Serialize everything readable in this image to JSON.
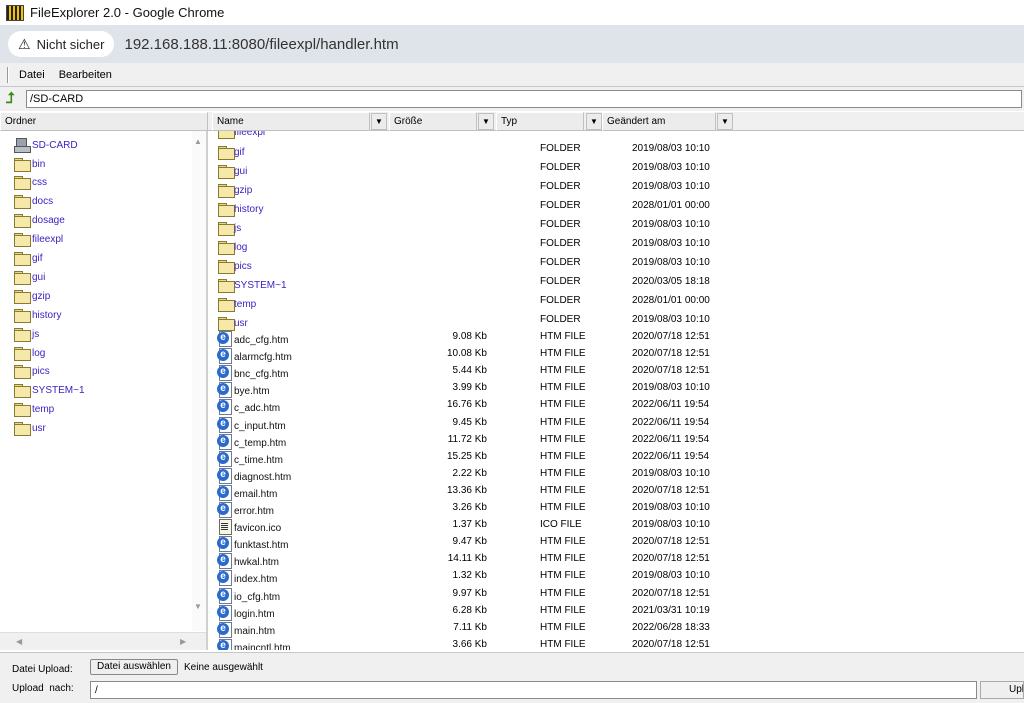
{
  "window": {
    "title": "FileExplorer 2.0 - Google Chrome"
  },
  "address": {
    "security_label": "Nicht sicher",
    "url": "192.168.188.11:8080/fileexpl/handler.htm"
  },
  "menu": {
    "items": [
      "Datei",
      "Bearbeiten"
    ]
  },
  "path": {
    "value": "/SD-CARD"
  },
  "columns": {
    "folder": "Ordner",
    "name": "Name",
    "size": "Größe",
    "type": "Typ",
    "changed": "Geändert am"
  },
  "tree": {
    "root": "SD-CARD",
    "items": [
      "bin",
      "css",
      "docs",
      "dosage",
      "fileexpl",
      "gif",
      "gui",
      "gzip",
      "history",
      "js",
      "log",
      "pics",
      "SYSTEM~1",
      "temp",
      "usr"
    ]
  },
  "files": {
    "partial_top": "fileexpl",
    "rows": [
      {
        "name": "gif",
        "size": "",
        "type": "FOLDER",
        "date": "2019/08/03 10:10",
        "icon": "folder-icon"
      },
      {
        "name": "gui",
        "size": "",
        "type": "FOLDER",
        "date": "2019/08/03 10:10",
        "icon": "folder-icon"
      },
      {
        "name": "gzip",
        "size": "",
        "type": "FOLDER",
        "date": "2019/08/03 10:10",
        "icon": "folder-icon"
      },
      {
        "name": "history",
        "size": "",
        "type": "FOLDER",
        "date": "2028/01/01 00:00",
        "icon": "folder-icon"
      },
      {
        "name": "js",
        "size": "",
        "type": "FOLDER",
        "date": "2019/08/03 10:10",
        "icon": "folder-icon"
      },
      {
        "name": "log",
        "size": "",
        "type": "FOLDER",
        "date": "2019/08/03 10:10",
        "icon": "folder-icon"
      },
      {
        "name": "pics",
        "size": "",
        "type": "FOLDER",
        "date": "2019/08/03 10:10",
        "icon": "folder-icon"
      },
      {
        "name": "SYSTEM~1",
        "size": "",
        "type": "FOLDER",
        "date": "2020/03/05 18:18",
        "icon": "folder-icon"
      },
      {
        "name": "temp",
        "size": "",
        "type": "FOLDER",
        "date": "2028/01/01 00:00",
        "icon": "folder-icon"
      },
      {
        "name": "usr",
        "size": "",
        "type": "FOLDER",
        "date": "2019/08/03 10:10",
        "icon": "folder-icon"
      },
      {
        "name": "adc_cfg.htm",
        "size": "9.08 Kb",
        "type": "HTM FILE",
        "date": "2020/07/18 12:51",
        "icon": "htm-file-icon"
      },
      {
        "name": "alarmcfg.htm",
        "size": "10.08 Kb",
        "type": "HTM FILE",
        "date": "2020/07/18 12:51",
        "icon": "htm-file-icon"
      },
      {
        "name": "bnc_cfg.htm",
        "size": "5.44 Kb",
        "type": "HTM FILE",
        "date": "2020/07/18 12:51",
        "icon": "htm-file-icon"
      },
      {
        "name": "bye.htm",
        "size": "3.99 Kb",
        "type": "HTM FILE",
        "date": "2019/08/03 10:10",
        "icon": "htm-file-icon"
      },
      {
        "name": "c_adc.htm",
        "size": "16.76 Kb",
        "type": "HTM FILE",
        "date": "2022/06/11 19:54",
        "icon": "htm-file-icon"
      },
      {
        "name": "c_input.htm",
        "size": "9.45 Kb",
        "type": "HTM FILE",
        "date": "2022/06/11 19:54",
        "icon": "htm-file-icon"
      },
      {
        "name": "c_temp.htm",
        "size": "11.72 Kb",
        "type": "HTM FILE",
        "date": "2022/06/11 19:54",
        "icon": "htm-file-icon"
      },
      {
        "name": "c_time.htm",
        "size": "15.25 Kb",
        "type": "HTM FILE",
        "date": "2022/06/11 19:54",
        "icon": "htm-file-icon"
      },
      {
        "name": "diagnost.htm",
        "size": "2.22 Kb",
        "type": "HTM FILE",
        "date": "2019/08/03 10:10",
        "icon": "htm-file-icon"
      },
      {
        "name": "email.htm",
        "size": "13.36 Kb",
        "type": "HTM FILE",
        "date": "2020/07/18 12:51",
        "icon": "htm-file-icon"
      },
      {
        "name": "error.htm",
        "size": "3.26 Kb",
        "type": "HTM FILE",
        "date": "2019/08/03 10:10",
        "icon": "htm-file-icon"
      },
      {
        "name": "favicon.ico",
        "size": "1.37 Kb",
        "type": "ICO FILE",
        "date": "2019/08/03 10:10",
        "icon": "ico-file-icon"
      },
      {
        "name": "funktast.htm",
        "size": "9.47 Kb",
        "type": "HTM FILE",
        "date": "2020/07/18 12:51",
        "icon": "htm-file-icon"
      },
      {
        "name": "hwkal.htm",
        "size": "14.11 Kb",
        "type": "HTM FILE",
        "date": "2020/07/18 12:51",
        "icon": "htm-file-icon"
      },
      {
        "name": "index.htm",
        "size": "1.32 Kb",
        "type": "HTM FILE",
        "date": "2019/08/03 10:10",
        "icon": "htm-file-icon"
      },
      {
        "name": "io_cfg.htm",
        "size": "9.97 Kb",
        "type": "HTM FILE",
        "date": "2020/07/18 12:51",
        "icon": "htm-file-icon"
      },
      {
        "name": "login.htm",
        "size": "6.28 Kb",
        "type": "HTM FILE",
        "date": "2021/03/31 10:19",
        "icon": "htm-file-icon"
      },
      {
        "name": "main.htm",
        "size": "7.11 Kb",
        "type": "HTM FILE",
        "date": "2022/06/28 18:33",
        "icon": "htm-file-icon"
      },
      {
        "name": "maincntl.htm",
        "size": "3.66 Kb",
        "type": "HTM FILE",
        "date": "2020/07/18 12:51",
        "icon": "htm-file-icon"
      }
    ]
  },
  "upload": {
    "file_label": "Datei Upload:",
    "choose_button": "Datei auswählen",
    "no_file": "Keine ausgewählt",
    "target_label": "Upload  nach:",
    "target_value": "/",
    "upload_button": "Upload"
  }
}
